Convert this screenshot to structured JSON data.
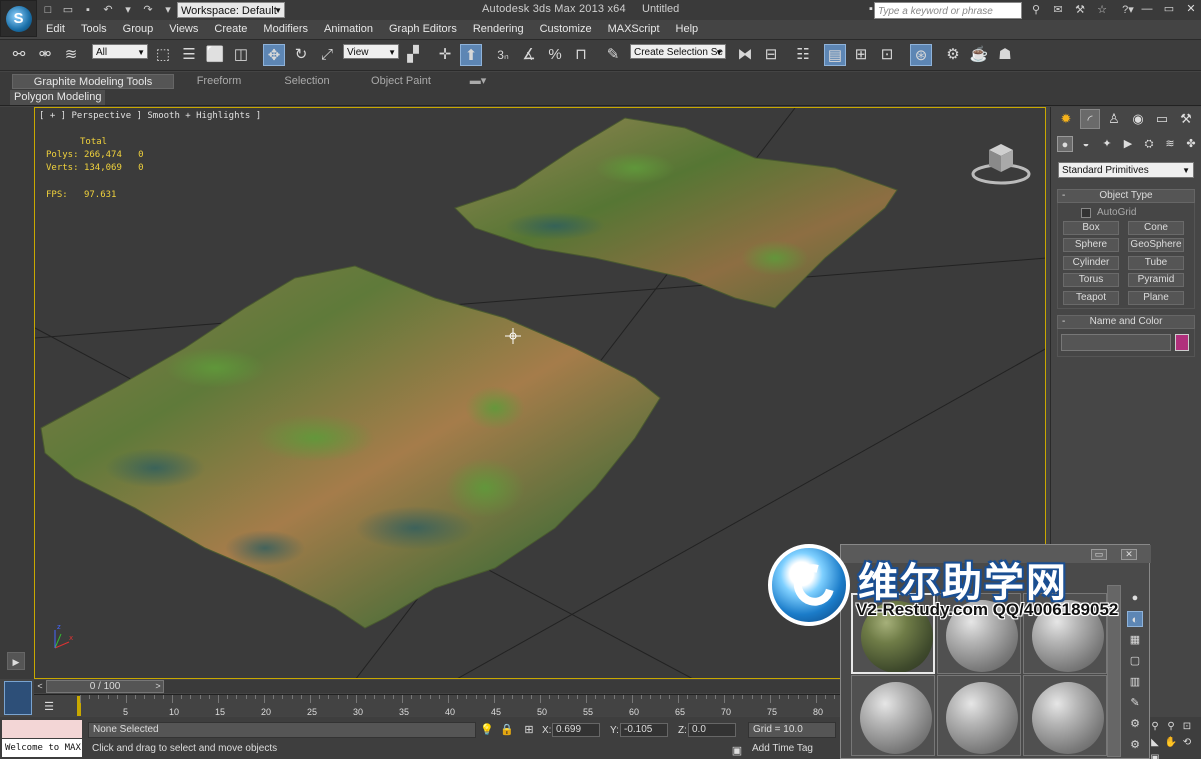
{
  "app": {
    "title": "Autodesk 3ds Max  2013 x64",
    "document": "Untitled",
    "logo_text": "S",
    "workspace": "Workspace: Default",
    "search_placeholder": "Type a keyword or phrase"
  },
  "menu": [
    "Edit",
    "Tools",
    "Group",
    "Views",
    "Create",
    "Modifiers",
    "Animation",
    "Graph Editors",
    "Rendering",
    "Customize",
    "MAXScript",
    "Help"
  ],
  "toolbar": {
    "filter": "All",
    "ref_coord": "View",
    "snap_label": "3",
    "selection_set": "Create Selection Se"
  },
  "ribbon": {
    "tabs": [
      "Graphite Modeling Tools",
      "Freeform",
      "Selection",
      "Object Paint"
    ],
    "active_tab": "Graphite Modeling Tools",
    "sub_label": "Polygon Modeling"
  },
  "viewport": {
    "label": "[ + ] Perspective ] Smooth + Highlights ]",
    "stats": {
      "header": "Total",
      "polys_label": "Polys:",
      "polys_value": "266,474",
      "polys_sel": "0",
      "verts_label": "Verts:",
      "verts_value": "134,069",
      "verts_sel": "0",
      "fps_label": "FPS:",
      "fps_value": "97.631"
    }
  },
  "command_panel": {
    "category": "Standard Primitives",
    "object_type_title": "Object Type",
    "autogrid": "AutoGrid",
    "primitives": [
      "Box",
      "Cone",
      "Sphere",
      "GeoSphere",
      "Cylinder",
      "Tube",
      "Torus",
      "Pyramid",
      "Teapot",
      "Plane"
    ],
    "name_color_title": "Name and Color",
    "swatch_color": "#b0307c"
  },
  "timeline": {
    "slider": "0 / 100",
    "ticks": [
      "5",
      "10",
      "15",
      "20",
      "25",
      "30",
      "35",
      "40",
      "45",
      "50",
      "55",
      "60",
      "65",
      "70",
      "75",
      "80"
    ]
  },
  "status": {
    "listener": "Welcome to MAX",
    "selection": "None Selected",
    "prompt": "Click and drag to select and move objects",
    "x_label": "X:",
    "x_value": "0.699",
    "y_label": "Y:",
    "y_value": "-0.105",
    "z_label": "Z:",
    "z_value": "0.0",
    "grid": "Grid = 10.0",
    "time_tag": "Add Time Tag"
  },
  "watermark": {
    "cn": "维尔助学网",
    "en": "V2-Restudy.com QQ/4006189052"
  },
  "colors": {
    "accent": "#5d86b4",
    "viewport_border": "#c8a800",
    "stats_text": "#f0d23c"
  }
}
